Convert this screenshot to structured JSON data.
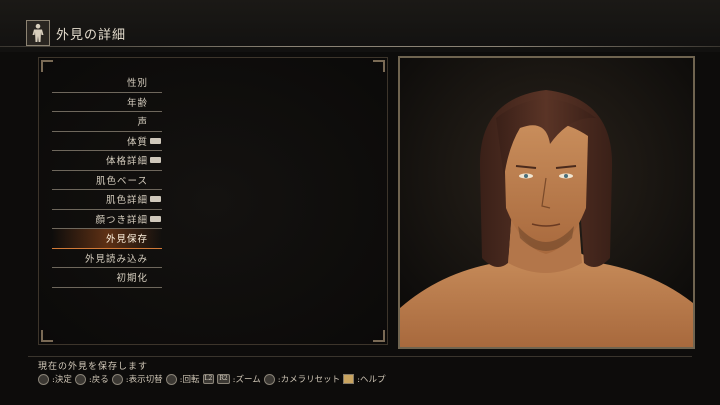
{
  "header": {
    "title": "外見の詳細"
  },
  "menu": {
    "items": [
      {
        "label": "性別",
        "has_icon": false
      },
      {
        "label": "年齢",
        "has_icon": false
      },
      {
        "label": "声",
        "has_icon": false
      },
      {
        "label": "体質",
        "has_icon": true
      },
      {
        "label": "体格詳細",
        "has_icon": true
      },
      {
        "label": "肌色ベース",
        "has_icon": false
      },
      {
        "label": "肌色詳細",
        "has_icon": true
      },
      {
        "label": "顔つき詳細",
        "has_icon": true
      },
      {
        "label": "外見保存",
        "has_icon": false,
        "selected": true
      },
      {
        "label": "外見読み込み",
        "has_icon": false
      },
      {
        "label": "初期化",
        "has_icon": false
      }
    ]
  },
  "footer": {
    "hint": "現在の外見を保存します",
    "controls": [
      {
        "icon": "circle-button-icon",
        "label": ":決定"
      },
      {
        "icon": "cross-button-icon",
        "label": ":戻る"
      },
      {
        "icon": "triangle-button-icon",
        "label": ":表示切替"
      },
      {
        "icon": "r-stick-icon",
        "label": ":回転"
      },
      {
        "icon": "l2-button-icon",
        "label": ""
      },
      {
        "icon": "r2-button-icon",
        "label": ":ズーム"
      },
      {
        "icon": "r3-button-icon",
        "label": ":カメラリセット"
      },
      {
        "icon": "touchpad-icon",
        "label": ":ヘルプ"
      }
    ]
  },
  "colors": {
    "accent": "#d27a38",
    "frame": "#6f6450"
  }
}
